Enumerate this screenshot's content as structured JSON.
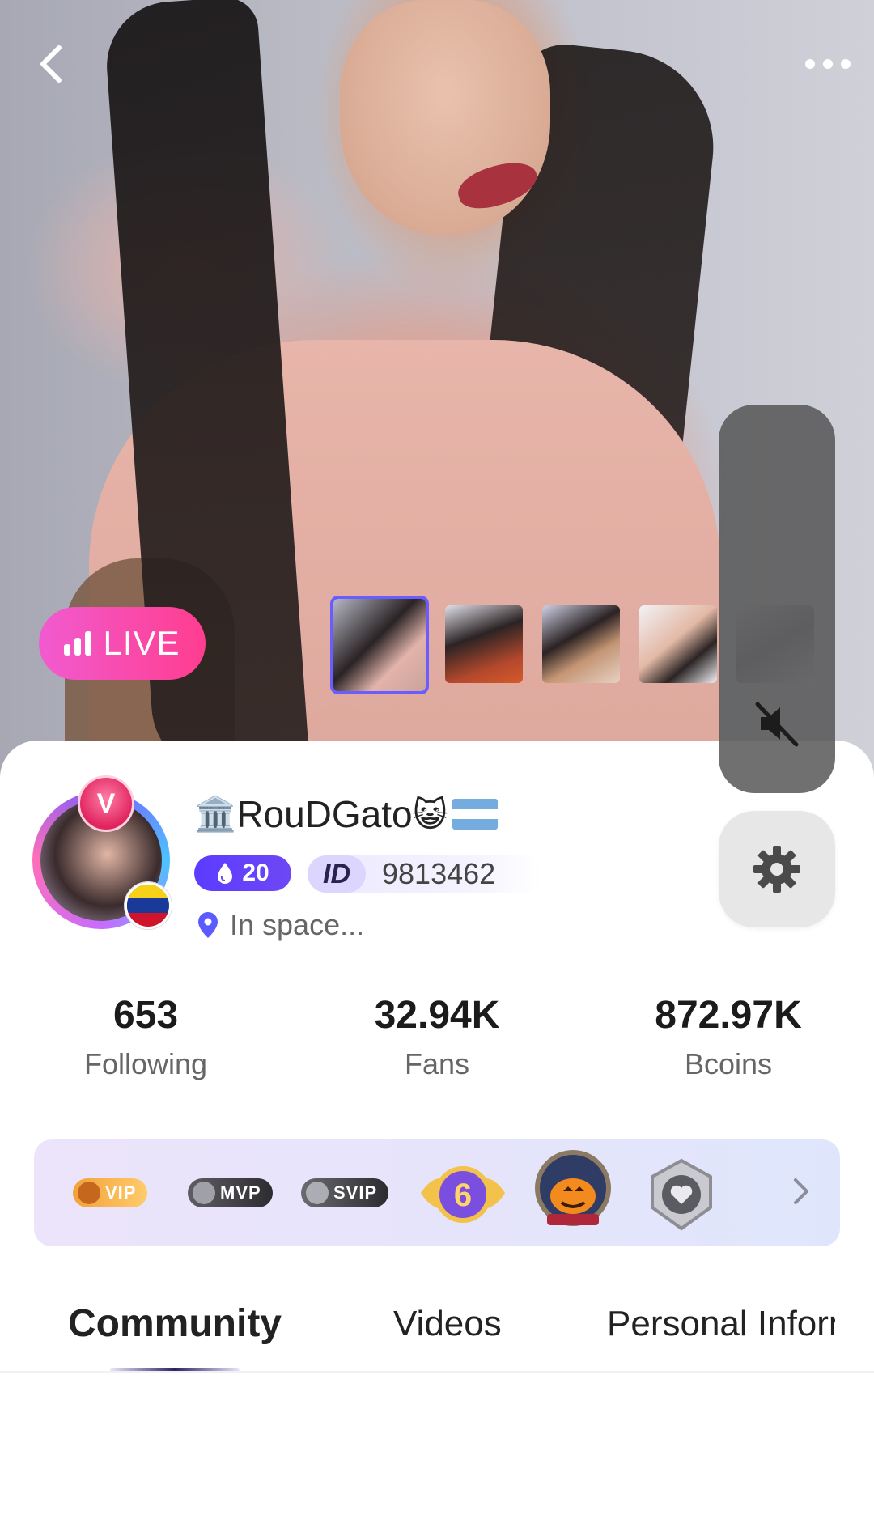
{
  "live_label": "LIVE",
  "profile": {
    "avatar_badge": "V",
    "username": "RouDGato",
    "username_prefix_emoji": "🏛️",
    "username_suffix_emoji": "😺",
    "level": "20",
    "id_label": "ID",
    "id_value": "9813462",
    "location": "In space..."
  },
  "stats": [
    {
      "value": "653",
      "label": "Following"
    },
    {
      "value": "32.94K",
      "label": "Fans"
    },
    {
      "value": "872.97K",
      "label": "Bcoins"
    }
  ],
  "medals": [
    {
      "label": "VIP",
      "icon": "vip-badge"
    },
    {
      "label": "MVP",
      "icon": "mvp-badge"
    },
    {
      "label": "SVIP",
      "icon": "svip-badge"
    },
    {
      "label": "6",
      "icon": "level-6-wings-medal"
    },
    {
      "label": "",
      "icon": "halloween-pumpkin-medal"
    },
    {
      "label": "",
      "icon": "silver-heart-medal"
    }
  ],
  "tabs": [
    {
      "label": "Community",
      "active": true
    },
    {
      "label": "Videos",
      "active": false
    },
    {
      "label": "Personal Inforr",
      "active": false
    }
  ],
  "colors": {
    "live_gradient_start": "#f15bd0",
    "live_gradient_end": "#ff3d8f",
    "level_badge": "#5d3bff",
    "thumb_selected_border": "#6a5cff",
    "location_pin": "#5b5bff"
  },
  "icons": {
    "back": "chevron-left-icon",
    "more": "more-horizontal-icon",
    "mute": "speaker-muted-icon",
    "settings": "gear-icon",
    "location": "location-pin-icon",
    "level": "drop-icon",
    "medals_more": "chevron-right-icon"
  }
}
